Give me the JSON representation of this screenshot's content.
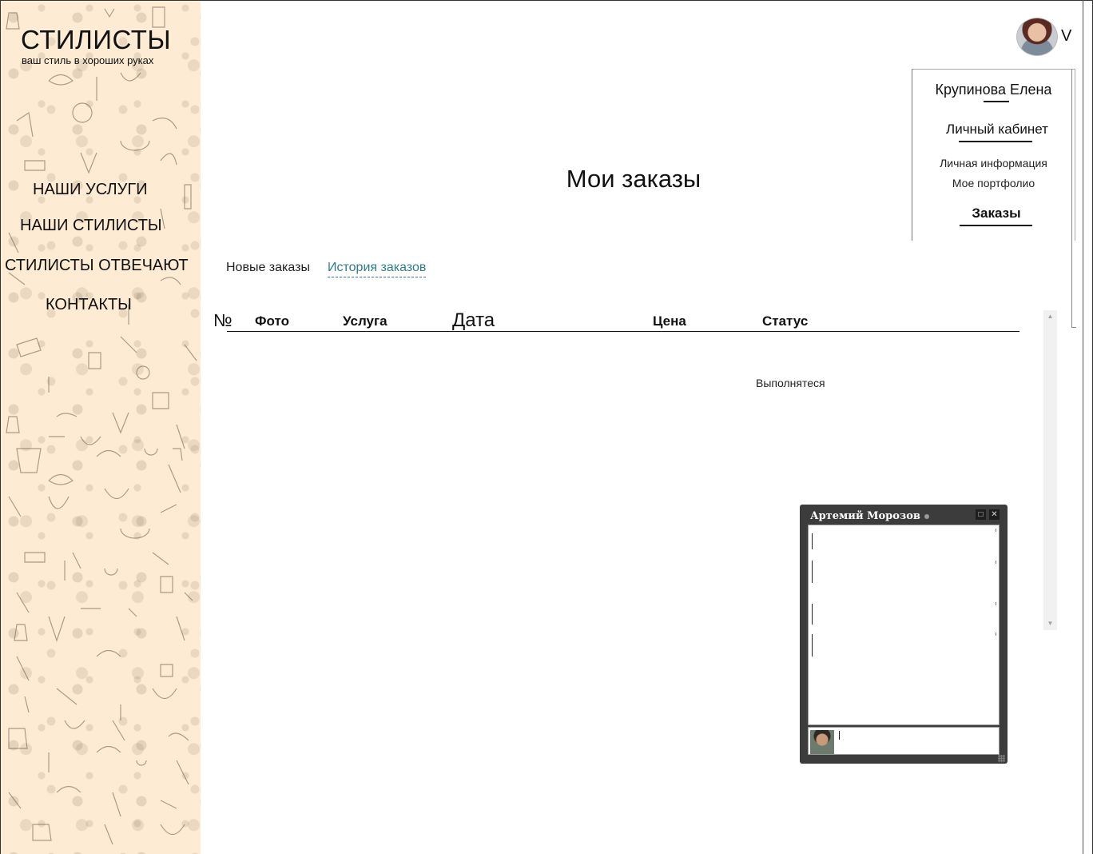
{
  "brand": {
    "title": "СТИЛИСТЫ",
    "tagline": "ваш стиль в хороших руках"
  },
  "nav": {
    "items": [
      {
        "label": "НАШИ УСЛУГИ"
      },
      {
        "label": "НАШИ СТИЛИСТЫ"
      },
      {
        "label": "СТИЛИСТЫ ОТВЕЧАЮТ"
      },
      {
        "label": "КОНТАКТЫ"
      }
    ]
  },
  "profile": {
    "dropdown_glyph": "V",
    "name": "Крупинова Елена",
    "cabinet": "Личный кабинет",
    "links": [
      "Личная информация",
      "Мое портфолио"
    ],
    "orders": "Заказы"
  },
  "page": {
    "title": "Мои заказы"
  },
  "tabs": {
    "new_orders": "Новые заказы",
    "history": "История заказов",
    "active": "history"
  },
  "table": {
    "columns": [
      "№",
      "Фото",
      "Услуга",
      "Дата",
      "Цена",
      "Статус"
    ],
    "rows": [
      {
        "status": "Выполнятеся"
      }
    ]
  },
  "chat": {
    "contact": "Артемий Морозов",
    "input_value": "",
    "minimize_glyph": "□",
    "close_glyph": "✕"
  },
  "colors": {
    "sidebar_bg": "#fdebd3",
    "tab_active": "#2f7e82",
    "chat_bg": "#3c3c3c"
  }
}
